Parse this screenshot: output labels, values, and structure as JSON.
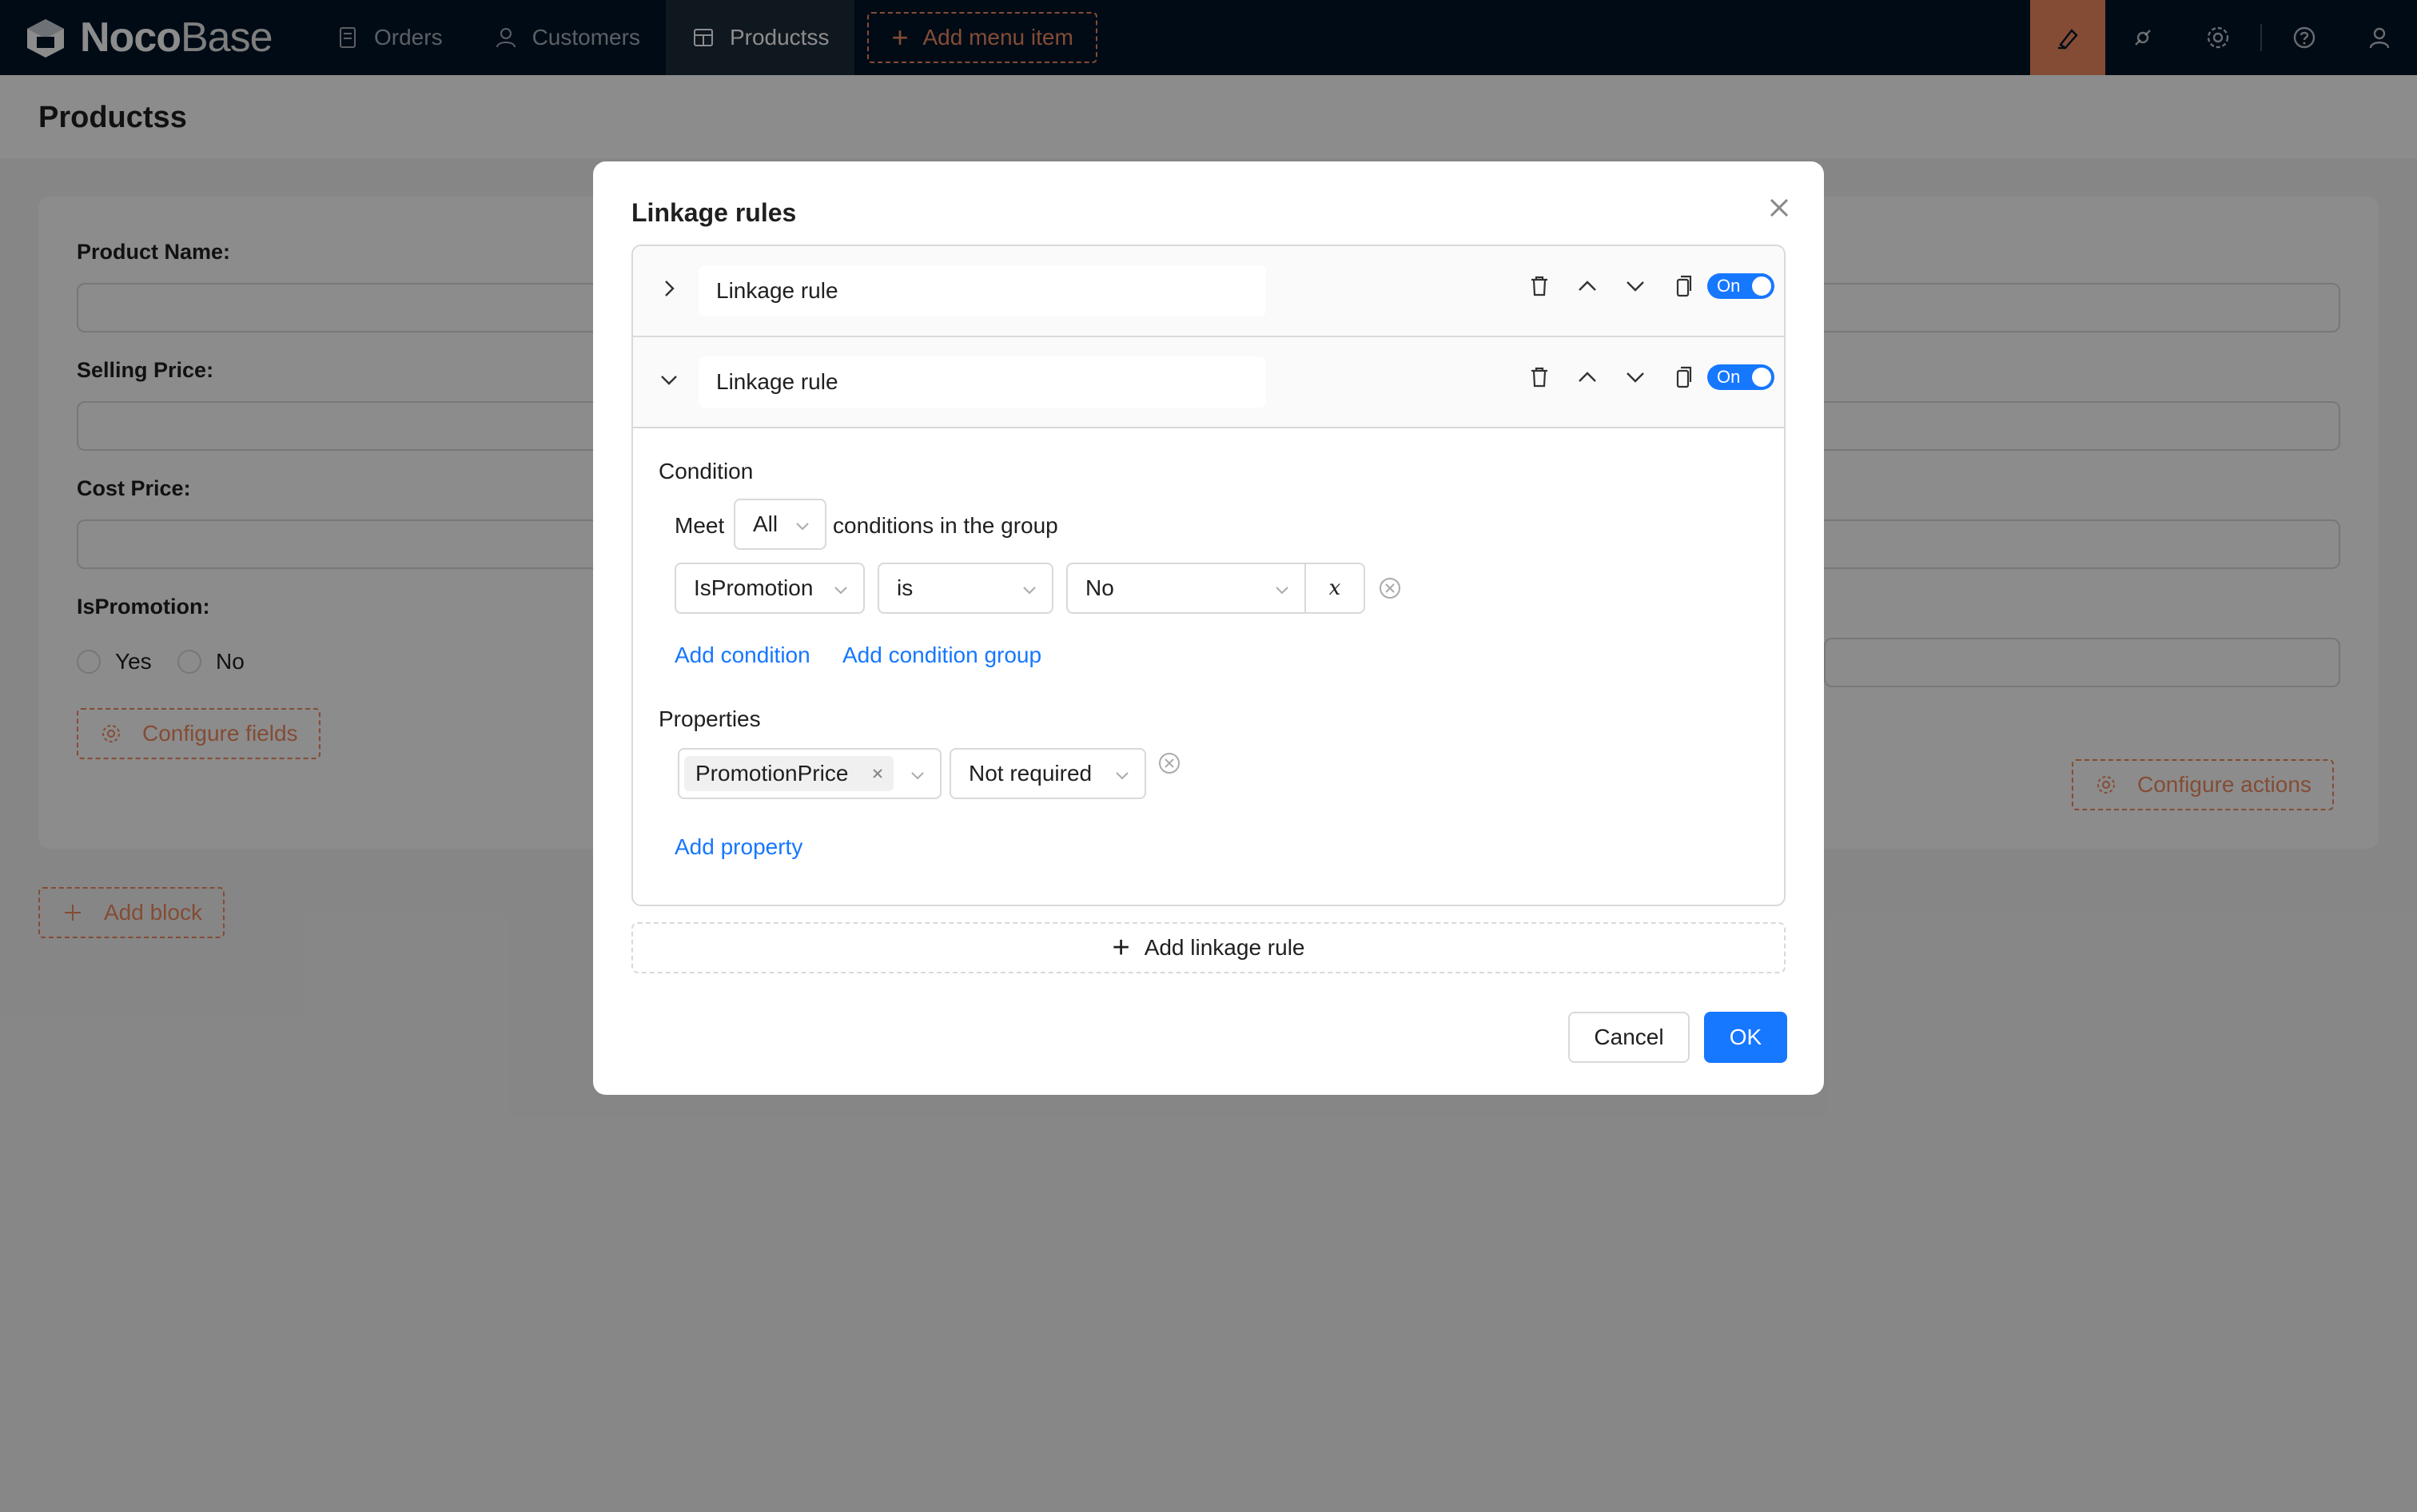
{
  "app": {
    "logo_bold": "Noco",
    "logo_light": "Base"
  },
  "nav": {
    "items": [
      {
        "label": "Orders",
        "icon": "file-icon"
      },
      {
        "label": "Customers",
        "icon": "user-icon"
      },
      {
        "label": "Productss",
        "icon": "table-icon",
        "active": true
      }
    ],
    "add_menu_label": "Add menu item",
    "right_icons": [
      "ui-editor-icon",
      "plugin-icon",
      "settings-icon",
      "help-icon",
      "account-icon"
    ]
  },
  "page": {
    "title": "Productss",
    "form": {
      "fields": [
        {
          "label": "Product Name"
        },
        {
          "label": "Selling Price"
        },
        {
          "label": "Cost Price"
        },
        {
          "label": "IsPromotion"
        }
      ],
      "radio_options": [
        "Yes",
        "No"
      ],
      "configure_fields_label": "Configure fields",
      "configure_actions_label": "Configure actions"
    },
    "add_block_label": "Add block"
  },
  "modal": {
    "title": "Linkage rules",
    "rules": [
      {
        "name": "Linkage rule",
        "expanded": false,
        "toggle_label": "On"
      },
      {
        "name": "Linkage rule",
        "expanded": true,
        "toggle_label": "On"
      }
    ],
    "condition": {
      "section_label": "Condition",
      "meet_prefix": "Meet",
      "meet_value": "All",
      "meet_suffix": "conditions in the group",
      "field": "IsPromotion",
      "operator": "is",
      "value": "No",
      "variable_symbol": "x",
      "add_condition": "Add condition",
      "add_condition_group": "Add condition group"
    },
    "properties": {
      "section_label": "Properties",
      "field_tag": "PromotionPrice",
      "value": "Not required",
      "add_property": "Add property"
    },
    "add_rule_label": "Add linkage rule",
    "cancel_label": "Cancel",
    "ok_label": "OK"
  },
  "colors": {
    "nav_bg": "#001529",
    "accent_orange": "#f18b62",
    "primary_blue": "#1677ff"
  }
}
